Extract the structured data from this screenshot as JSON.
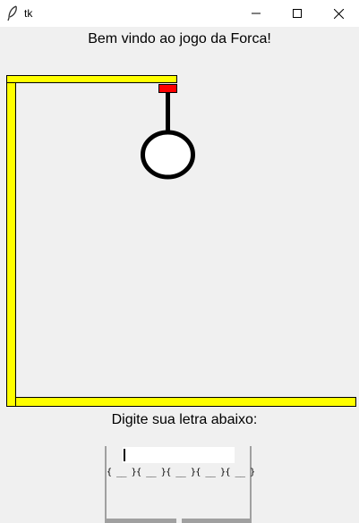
{
  "window": {
    "title": "tk",
    "icon": "feather-icon",
    "buttons": [
      "minimize-icon",
      "maximize-icon",
      "close-icon"
    ]
  },
  "game": {
    "welcome": "Bem vindo ao jogo da Forca!",
    "prompt": "Digite sua letra abaixo:",
    "letter_input_value": "",
    "word_slots": "{ __ }{ __ }{ __ }{ __ }{ __ }"
  },
  "colors": {
    "gallows_fill": "#ffff00",
    "rope_knot": "#ff0000",
    "background": "#f0f0f0"
  }
}
